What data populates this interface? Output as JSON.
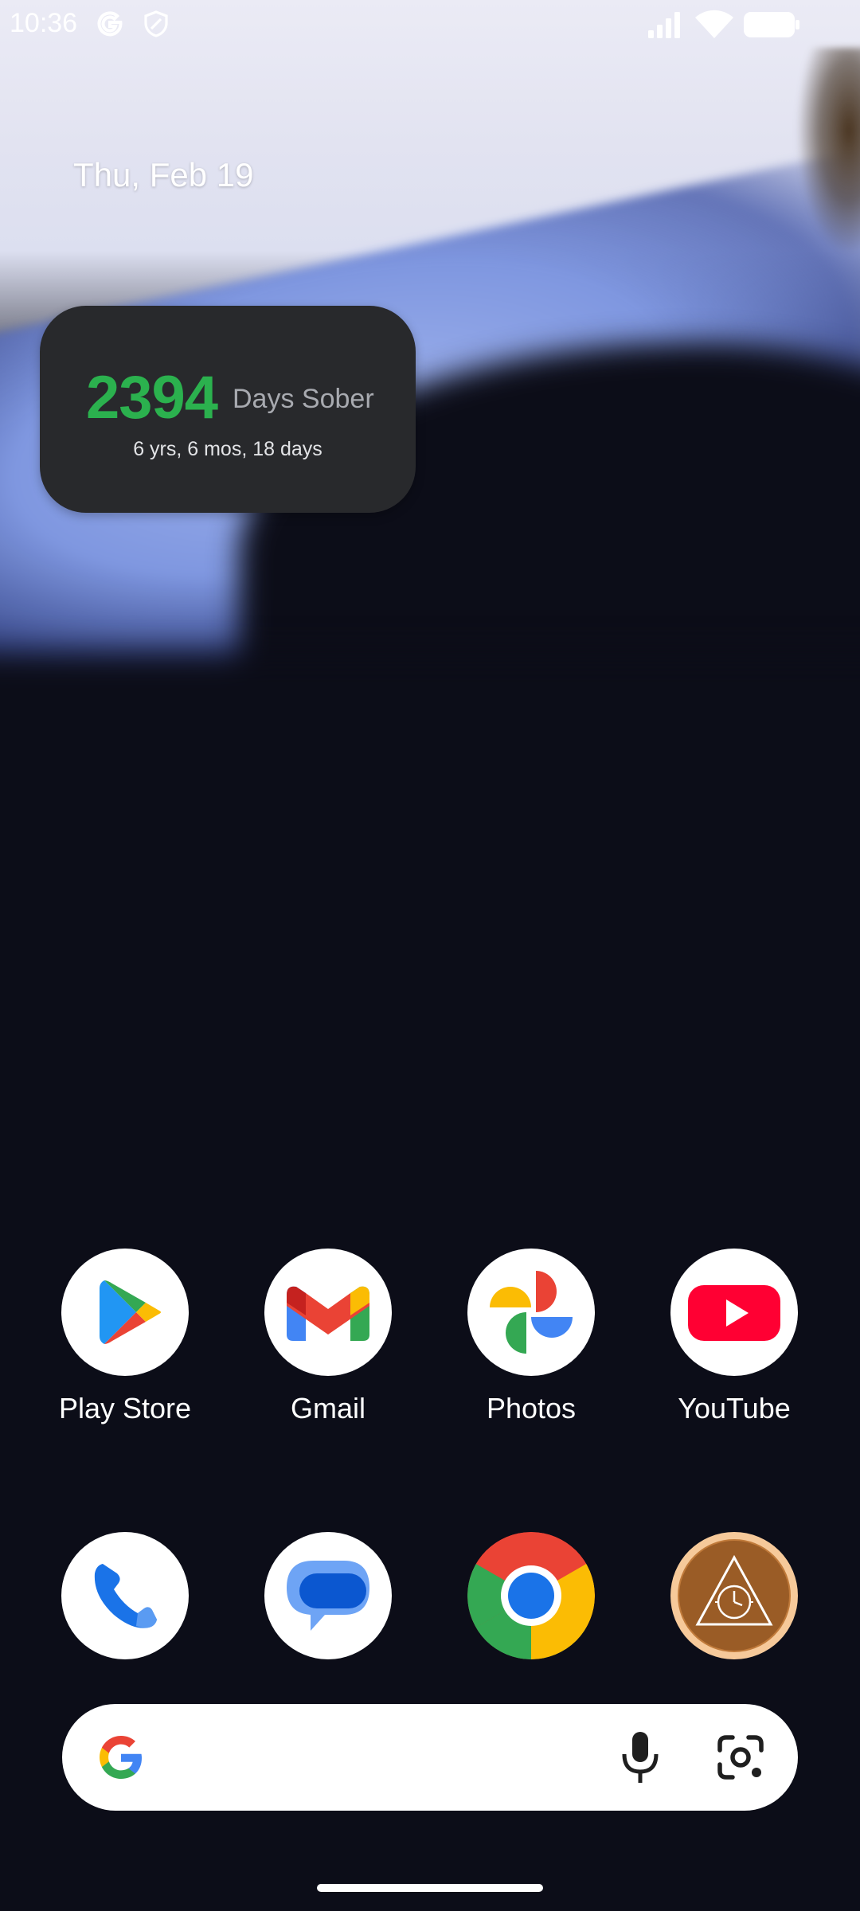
{
  "status_bar": {
    "time": "10:36",
    "icons": [
      "google-g-icon",
      "shield-icon",
      "signal-icon",
      "wifi-icon",
      "battery-icon"
    ]
  },
  "date": "Thu, Feb 19",
  "widget": {
    "count": "2394",
    "label": "Days Sober",
    "detail": "6 yrs, 6 mos, 18 days",
    "count_color": "#2bb14e",
    "background": "#28292c"
  },
  "apps_row1": [
    {
      "label": "Play Store",
      "icon": "play-store-icon"
    },
    {
      "label": "Gmail",
      "icon": "gmail-icon"
    },
    {
      "label": "Photos",
      "icon": "photos-icon"
    },
    {
      "label": "YouTube",
      "icon": "youtube-icon"
    }
  ],
  "dock": [
    {
      "icon": "phone-icon"
    },
    {
      "icon": "messages-icon"
    },
    {
      "icon": "chrome-icon"
    },
    {
      "icon": "sobriety-clock-icon"
    }
  ],
  "search_bar": {
    "icons": [
      "google-g-icon",
      "microphone-icon",
      "google-lens-icon"
    ]
  }
}
